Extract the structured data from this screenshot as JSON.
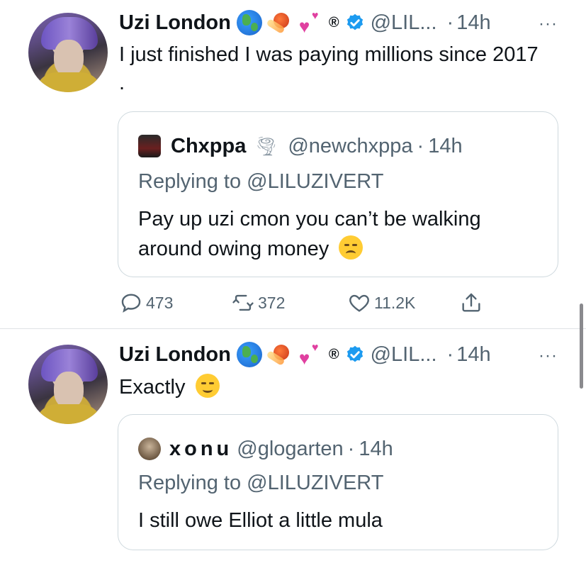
{
  "tweets": [
    {
      "author": {
        "name": "Uzi London",
        "emojis": [
          "globe-icon",
          "comet-icon",
          "heart-icon",
          "registered-icon",
          "verified-badge-icon"
        ],
        "registered_symbol": "®",
        "handle": "@LIL...",
        "time": "14h"
      },
      "more_icon": "···",
      "text": "I just finished I was paying millions since 2017 .",
      "quote": {
        "name": "Chxppa",
        "handle": "@newchxppa",
        "time": "14h",
        "replying_to": "Replying to @LILUZIVERT",
        "text": "Pay up uzi cmon you can’t be walking around owing money"
      },
      "actions": {
        "replies": "473",
        "retweets": "372",
        "likes": "11.2K"
      }
    },
    {
      "author": {
        "name": "Uzi London",
        "emojis": [
          "globe-icon",
          "comet-icon",
          "heart-icon",
          "registered-icon",
          "verified-badge-icon"
        ],
        "registered_symbol": "®",
        "handle": "@LIL...",
        "time": "14h"
      },
      "more_icon": "···",
      "text": "Exactly",
      "quote": {
        "name": "xonu",
        "handle": "@glogarten",
        "time": "14h",
        "replying_to": "Replying to @LILUZIVERT",
        "text": "I still owe Elliot a little mula"
      }
    }
  ],
  "separator": "·",
  "colors": {
    "text_primary": "#0f1419",
    "text_secondary": "#536471",
    "border": "#cfd9de",
    "verified": "#1d9bf0"
  }
}
